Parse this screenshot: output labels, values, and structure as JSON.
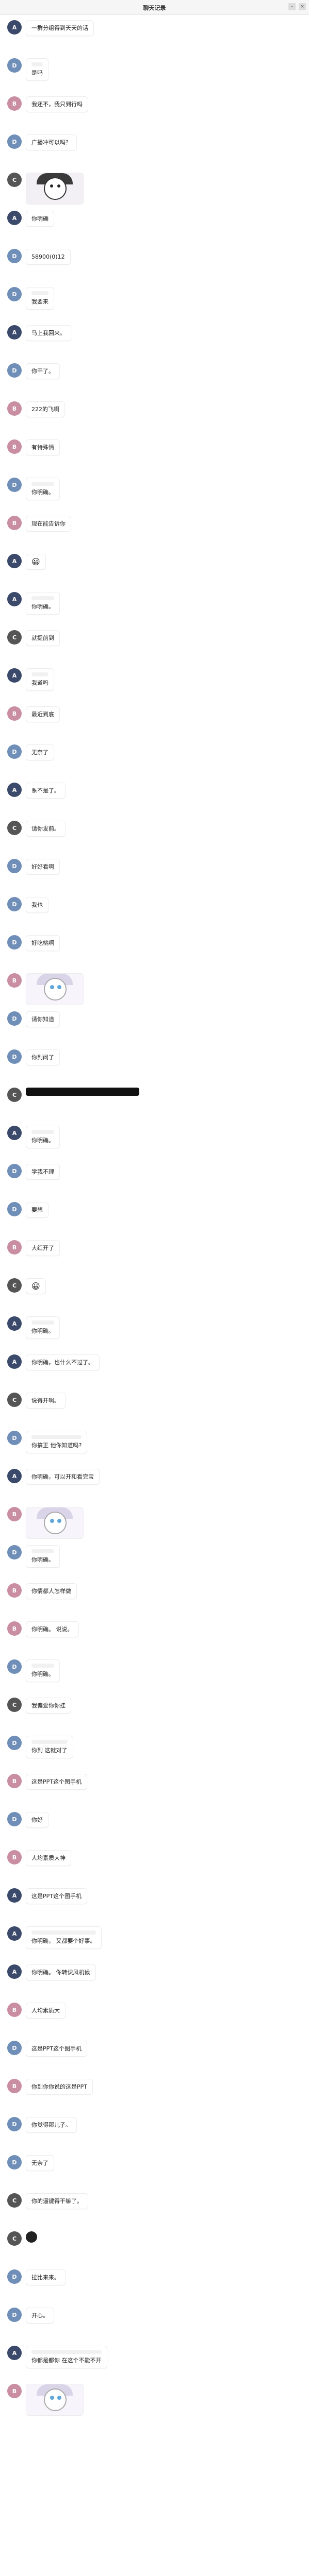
{
  "window": {
    "title": "聊天记录",
    "close": "×",
    "min": "–"
  },
  "date": "",
  "avatars": {
    "a": {
      "color": "#3b4a6b",
      "label": "A"
    },
    "b": {
      "color": "#c98ea2",
      "label": "B"
    },
    "c": {
      "color": "#555555",
      "label": "C"
    },
    "d": {
      "color": "#6f8fb8",
      "label": "D"
    }
  },
  "messages": [
    {
      "av": "a",
      "sender": "",
      "text": "一群分组得到天天的话",
      "quote": null,
      "kind": "text"
    },
    {
      "av": "d",
      "sender": "",
      "text": "是吗",
      "quote": {
        "name": "",
        "text": ""
      },
      "kind": "text"
    },
    {
      "av": "b",
      "sender": "",
      "text": "我还不，我只到行吗",
      "quote": null,
      "kind": "text"
    },
    {
      "av": "d",
      "sender": "",
      "text": "广播冲可以吗？",
      "quote": null,
      "kind": "text"
    },
    {
      "av": "c",
      "sender": "",
      "text": "",
      "quote": null,
      "kind": "sticker"
    },
    {
      "av": "a",
      "sender": "",
      "text": "你明确",
      "quote": null,
      "kind": "text"
    },
    {
      "av": "d",
      "sender": "",
      "text": "58900(0)12",
      "quote": null,
      "kind": "text"
    },
    {
      "av": "d",
      "sender": "",
      "text": "我要来",
      "quote": {
        "name": "",
        "text": ""
      },
      "kind": "text"
    },
    {
      "av": "a",
      "sender": "",
      "text": "马上我回来。",
      "quote": null,
      "kind": "text"
    },
    {
      "av": "d",
      "sender": "",
      "text": "你干了。",
      "quote": null,
      "kind": "text"
    },
    {
      "av": "b",
      "sender": "",
      "text": "222的飞啊",
      "quote": null,
      "kind": "text"
    },
    {
      "av": "b",
      "sender": "",
      "text": "有特殊情",
      "quote": null,
      "kind": "text"
    },
    {
      "av": "d",
      "sender": "",
      "text": "你明确。",
      "quote": {
        "name": "",
        "text": ""
      },
      "kind": "text"
    },
    {
      "av": "b",
      "sender": "",
      "text": "现在能告诉你",
      "quote": null,
      "kind": "text"
    },
    {
      "av": "a",
      "sender": "",
      "text": "😀",
      "quote": null,
      "kind": "emoji"
    },
    {
      "av": "a",
      "sender": "",
      "text": "你明确。",
      "quote": {
        "name": "",
        "text": ""
      },
      "kind": "text"
    },
    {
      "av": "c",
      "sender": "",
      "text": "就提前到",
      "quote": null,
      "kind": "text"
    },
    {
      "av": "a",
      "sender": "",
      "text": "我道吗",
      "quote": {
        "name": "",
        "text": ""
      },
      "kind": "text"
    },
    {
      "av": "b",
      "sender": "",
      "text": "最近到底",
      "quote": null,
      "kind": "text"
    },
    {
      "av": "d",
      "sender": "",
      "text": "无奈了",
      "quote": null,
      "kind": "text"
    },
    {
      "av": "a",
      "sender": "",
      "text": "系不是了。",
      "quote": null,
      "kind": "text"
    },
    {
      "av": "c",
      "sender": "",
      "text": "请你发前。",
      "quote": null,
      "kind": "text"
    },
    {
      "av": "d",
      "sender": "",
      "text": "好好看啊",
      "quote": null,
      "kind": "text"
    },
    {
      "av": "d",
      "sender": "",
      "text": "我也",
      "quote": null,
      "kind": "text"
    },
    {
      "av": "d",
      "sender": "",
      "text": "好吃桃啊",
      "quote": null,
      "kind": "text"
    },
    {
      "av": "b",
      "sender": "",
      "text": "",
      "quote": null,
      "kind": "sticker-light"
    },
    {
      "av": "d",
      "sender": "",
      "text": "请你知道",
      "quote": null,
      "kind": "text"
    },
    {
      "av": "d",
      "sender": "",
      "text": "你到问了",
      "quote": null,
      "kind": "text"
    },
    {
      "av": "c",
      "sender": "",
      "text": "",
      "quote": null,
      "kind": "dark"
    },
    {
      "av": "a",
      "sender": "",
      "text": "你明确。",
      "quote": {
        "name": "",
        "text": ""
      },
      "kind": "text"
    },
    {
      "av": "d",
      "sender": "",
      "text": "学我不理",
      "quote": null,
      "kind": "text"
    },
    {
      "av": "d",
      "sender": "",
      "text": "要想",
      "quote": null,
      "kind": "text"
    },
    {
      "av": "b",
      "sender": "",
      "text": "大红开了",
      "quote": null,
      "kind": "text"
    },
    {
      "av": "c",
      "sender": "",
      "text": "😀",
      "quote": null,
      "kind": "emoji"
    },
    {
      "av": "a",
      "sender": "",
      "text": "你明确。",
      "quote": {
        "name": "",
        "text": ""
      },
      "kind": "text"
    },
    {
      "av": "a",
      "sender": "",
      "text": "你明确，也什么不过了。",
      "quote": null,
      "kind": "text"
    },
    {
      "av": "c",
      "sender": "",
      "text": "说得开啊。",
      "quote": null,
      "kind": "text"
    },
    {
      "av": "d",
      "sender": "",
      "text": "你搞正 他你知道吗?",
      "quote": {
        "name": "",
        "text": ""
      },
      "kind": "text"
    },
    {
      "av": "a",
      "sender": "",
      "text": "你明确，可以开和看完宝",
      "quote": null,
      "kind": "text"
    },
    {
      "av": "b",
      "sender": "",
      "text": "",
      "quote": null,
      "kind": "sticker-light"
    },
    {
      "av": "d",
      "sender": "",
      "text": "你明确。",
      "quote": {
        "name": "",
        "text": ""
      },
      "kind": "text"
    },
    {
      "av": "b",
      "sender": "",
      "text": "你情都人怎样做",
      "quote": null,
      "kind": "text"
    },
    {
      "av": "b",
      "sender": "",
      "text": "你明确。 说说。",
      "quote": null,
      "kind": "text"
    },
    {
      "av": "d",
      "sender": "",
      "text": "你明确。",
      "quote": {
        "name": "",
        "text": ""
      },
      "kind": "text"
    },
    {
      "av": "c",
      "sender": "",
      "text": "我偏爱你你挂",
      "quote": null,
      "kind": "text"
    },
    {
      "av": "d",
      "sender": "",
      "text": "你到 这就对了",
      "quote": {
        "name": "",
        "text": ""
      },
      "kind": "text"
    },
    {
      "av": "b",
      "sender": "",
      "text": "这是PPT这个图手机",
      "quote": null,
      "kind": "text"
    },
    {
      "av": "d",
      "sender": "",
      "text": "你好",
      "quote": null,
      "kind": "text"
    },
    {
      "av": "b",
      "sender": "",
      "text": "人均素质大神",
      "quote": null,
      "kind": "text"
    },
    {
      "av": "a",
      "sender": "",
      "text": "这是PPT这个图手机",
      "quote": null,
      "kind": "text"
    },
    {
      "av": "a",
      "sender": "",
      "text": "你明确， 又都要个好事。",
      "quote": {
        "name": "",
        "text": ""
      },
      "kind": "text"
    },
    {
      "av": "a",
      "sender": "",
      "text": "你明确。 你转识风机候",
      "quote": null,
      "kind": "text"
    },
    {
      "av": "b",
      "sender": "",
      "text": "人均素质大",
      "quote": null,
      "kind": "text"
    },
    {
      "av": "d",
      "sender": "",
      "text": "这是PPT这个图手机",
      "quote": null,
      "kind": "text"
    },
    {
      "av": "b",
      "sender": "",
      "text": "你到你你说的这是PPT",
      "quote": null,
      "kind": "text"
    },
    {
      "av": "d",
      "sender": "",
      "text": "你觉得那儿子。",
      "quote": null,
      "kind": "text"
    },
    {
      "av": "d",
      "sender": "",
      "text": "无奈了",
      "quote": null,
      "kind": "text"
    },
    {
      "av": "c",
      "sender": "",
      "text": "你的逼键得干嘛了。",
      "quote": null,
      "kind": "text"
    },
    {
      "av": "c",
      "sender": "",
      "text": "",
      "quote": null,
      "kind": "icon"
    },
    {
      "av": "d",
      "sender": "",
      "text": "拉比来来。",
      "quote": null,
      "kind": "text"
    },
    {
      "av": "d",
      "sender": "",
      "text": "开心。",
      "quote": null,
      "kind": "text"
    },
    {
      "av": "a",
      "sender": "",
      "text": "你都是都你 在这个不能不开",
      "quote": {
        "name": "",
        "text": ""
      },
      "kind": "text"
    },
    {
      "av": "b",
      "sender": "",
      "text": "",
      "quote": null,
      "kind": "sticker-light"
    }
  ]
}
